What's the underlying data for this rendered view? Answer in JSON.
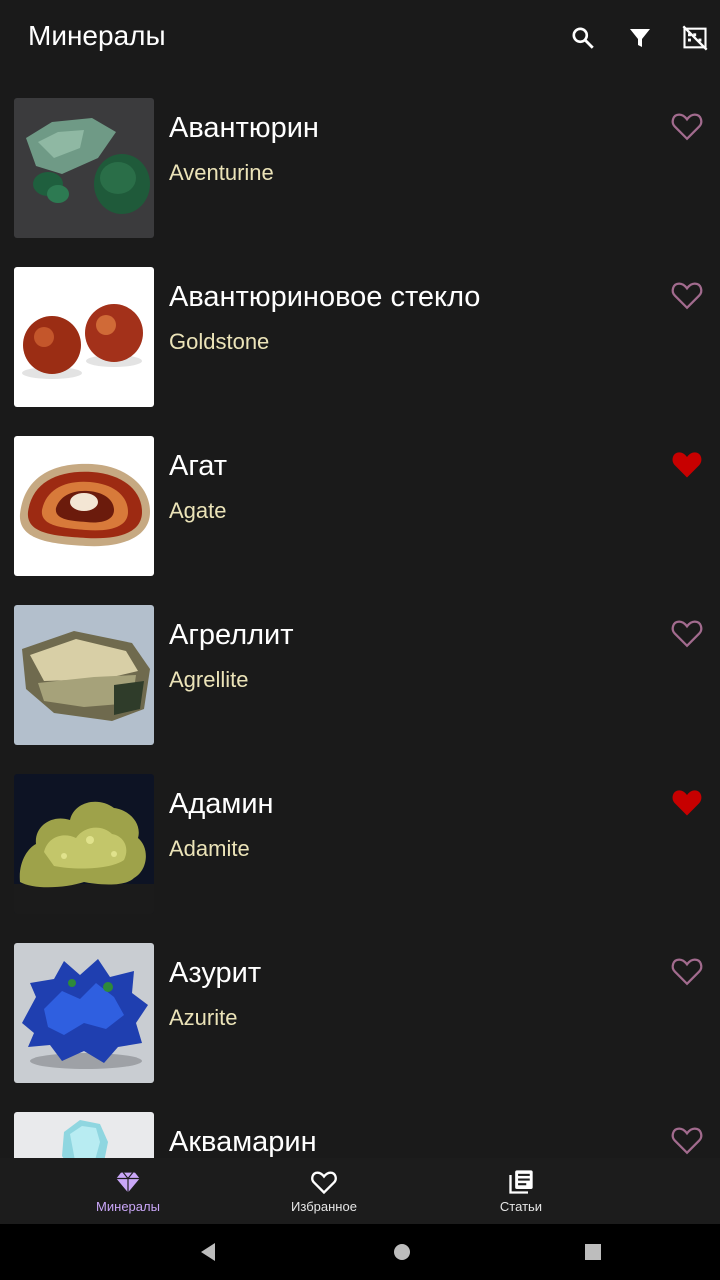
{
  "header": {
    "title": "Минералы"
  },
  "minerals": [
    {
      "name": "Авантюрин",
      "latin": "Aventurine",
      "favorite": false
    },
    {
      "name": "Авантюриновое стекло",
      "latin": "Goldstone",
      "favorite": false
    },
    {
      "name": "Агат",
      "latin": "Agate",
      "favorite": true
    },
    {
      "name": "Агреллит",
      "latin": "Agrellite",
      "favorite": false
    },
    {
      "name": "Адамин",
      "latin": "Adamite",
      "favorite": true
    },
    {
      "name": "Азурит",
      "latin": "Azurite",
      "favorite": false
    },
    {
      "name": "Аквамарин",
      "latin": "",
      "favorite": false
    }
  ],
  "nav": {
    "tabs": [
      {
        "label": "Минералы",
        "icon": "gem-icon",
        "active": true
      },
      {
        "label": "Избранное",
        "icon": "heart-outline-icon",
        "active": false
      },
      {
        "label": "Статьи",
        "icon": "articles-icon",
        "active": false
      }
    ]
  },
  "colors": {
    "accent": "#c9a6f7",
    "favorite": "#c70000",
    "latin_text": "#ebe3b8",
    "fav_outline": "#a26b8e"
  }
}
